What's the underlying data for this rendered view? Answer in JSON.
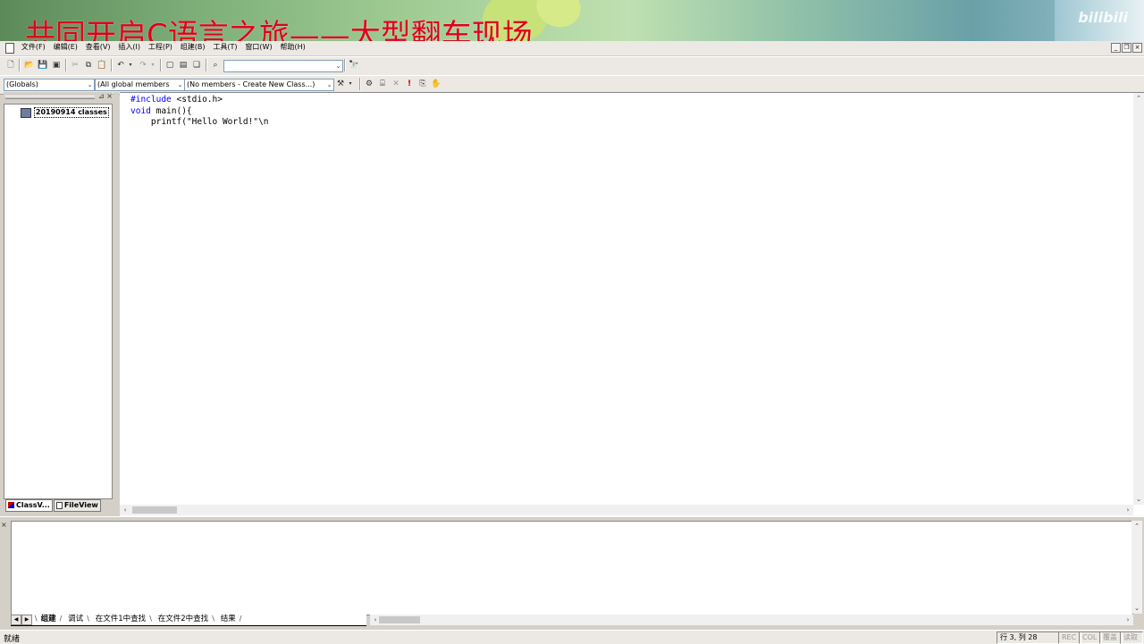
{
  "banner": {
    "title": "共同开启C语言之旅——大型翻车现场",
    "watermark": "bilibili"
  },
  "menubar": {
    "items": [
      "文件(F)",
      "编辑(E)",
      "查看(V)",
      "插入(I)",
      "工程(P)",
      "组建(B)",
      "工具(T)",
      "窗口(W)",
      "帮助(H)"
    ]
  },
  "toolbar2": {
    "scope_combo": "(Globals)",
    "members_combo": "(All global members",
    "function_combo": "(No members - Create New Class...)"
  },
  "workspace": {
    "tree_root": "20190914 classes",
    "tabs": [
      "ClassV...",
      "FileView"
    ]
  },
  "editor": {
    "lines": [
      {
        "kw": "#include",
        "rest": " <stdio.h>"
      },
      {
        "kw": "void",
        "rest": " main(){"
      },
      {
        "kw": "",
        "rest": "    printf(\"Hello World!\"\\n"
      }
    ]
  },
  "output": {
    "tabs": [
      "组建",
      "调试",
      "在文件1中查找",
      "在文件2中查找",
      "结果"
    ]
  },
  "status": {
    "text": "就绪",
    "position": "行 3, 列 28",
    "indicators": [
      "REC",
      "COL",
      "覆盖",
      "读取"
    ]
  },
  "colors": {
    "banner_title": "#e0001a",
    "keyword": "#0000ff",
    "chrome": "#d4d0c8"
  }
}
